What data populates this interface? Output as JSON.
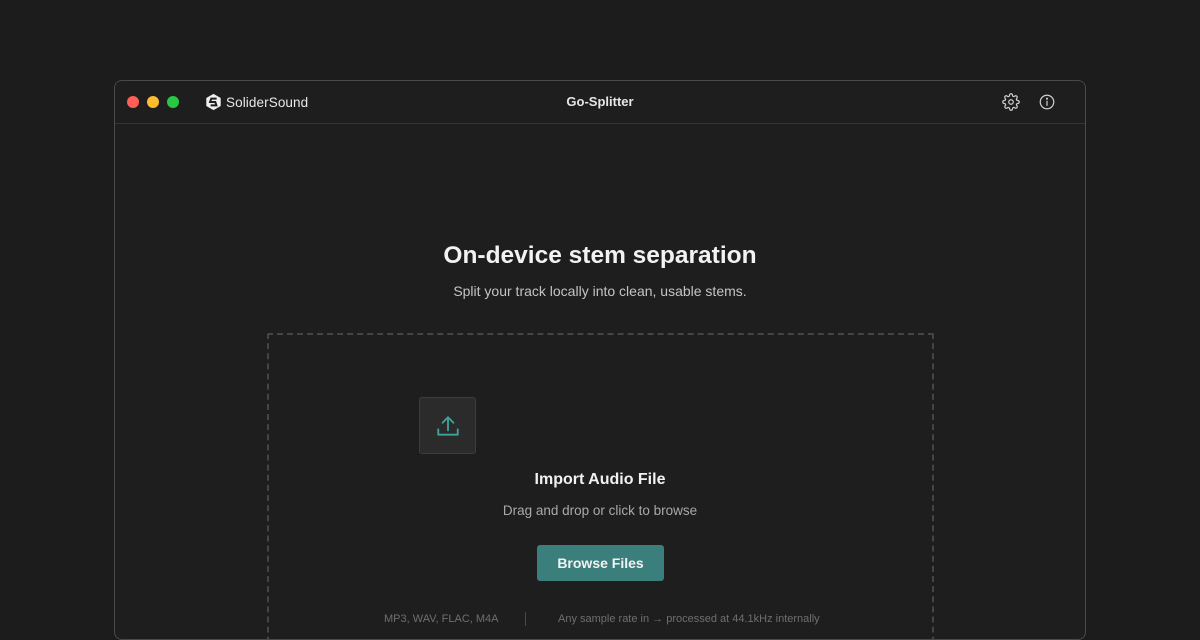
{
  "titlebar": {
    "brand_name": "SoliderSound",
    "window_title": "Go-Splitter",
    "icons": [
      "gear-icon",
      "info-icon"
    ]
  },
  "main": {
    "headline": "On-device stem separation",
    "subheadline": "Split your track locally into clean, usable stems."
  },
  "dropzone": {
    "icon": "upload-icon",
    "title": "Import Audio File",
    "subtitle": "Drag and drop or click to browse",
    "button_label": "Browse Files",
    "formats_note": "MP3, WAV, FLAC, M4A",
    "sample_rate_note": "Any sample rate in → processed at 44.1kHz internally"
  },
  "colors": {
    "accent": "#3b7f7d",
    "upload_icon": "#3fa39b",
    "background": "#1c1c1c",
    "window": "#1e1e1e"
  }
}
